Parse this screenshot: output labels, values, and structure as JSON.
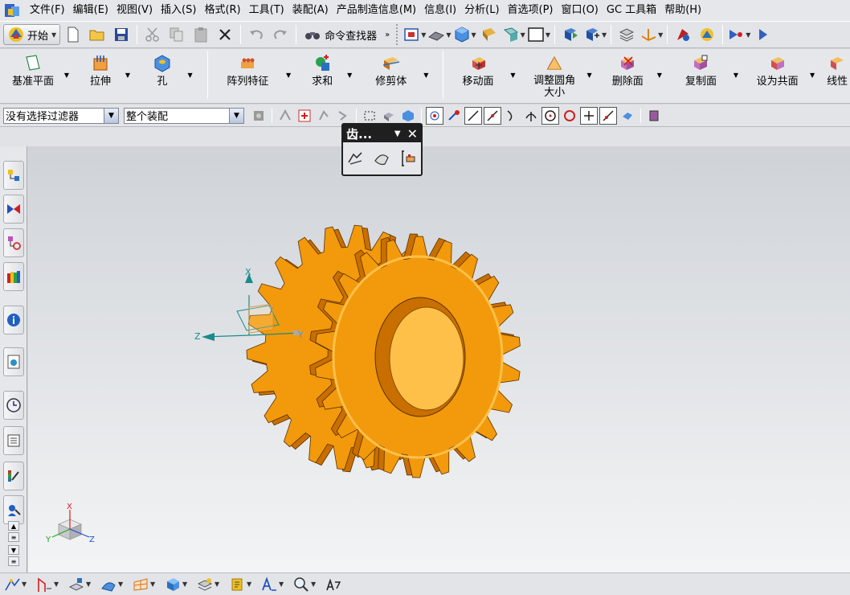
{
  "menubar": {
    "items": [
      "文件(F)",
      "编辑(E)",
      "视图(V)",
      "插入(S)",
      "格式(R)",
      "工具(T)",
      "装配(A)",
      "产品制造信息(M)",
      "信息(I)",
      "分析(L)",
      "首选项(P)",
      "窗口(O)",
      "GC 工具箱",
      "帮助(H)"
    ]
  },
  "stdbar": {
    "start_label": "开始",
    "command_finder_label": "命令查找器"
  },
  "featbar": {
    "items": [
      {
        "label": "基准平面",
        "icon": "datum-plane-icon"
      },
      {
        "label": "拉伸",
        "icon": "extrude-icon"
      },
      {
        "label": "孔",
        "icon": "hole-icon"
      },
      {
        "label": "阵列特征",
        "icon": "pattern-feature-icon"
      },
      {
        "label": "求和",
        "icon": "unite-icon"
      },
      {
        "label": "修剪体",
        "icon": "trim-body-icon"
      },
      {
        "label": "移动面",
        "icon": "move-face-icon"
      },
      {
        "label": "调整圆角",
        "label2": "大小",
        "icon": "resize-blend-icon"
      },
      {
        "label": "删除面",
        "icon": "delete-face-icon"
      },
      {
        "label": "复制面",
        "icon": "copy-face-icon"
      },
      {
        "label": "设为共面",
        "icon": "make-coplanar-icon"
      },
      {
        "label": "线性",
        "icon": "linear-dimension-icon"
      }
    ]
  },
  "selbar": {
    "filter_value": "没有选择过滤器",
    "scope_value": "整个装配"
  },
  "palette": {
    "title": "齿..."
  },
  "colors": {
    "gear": "#f29a0c",
    "gear_dark": "#c86f00",
    "gear_light": "#ffc04a",
    "wcs": "#1a8a8a",
    "axis_red": "#d02020",
    "axis_green": "#22aa22",
    "axis_blue": "#2050d0"
  },
  "csys": {
    "x_label": "X",
    "y_label": "Y",
    "z_label": "Z"
  },
  "triad": {
    "x_label": "X",
    "y_label": "Y",
    "z_label": "Z"
  }
}
